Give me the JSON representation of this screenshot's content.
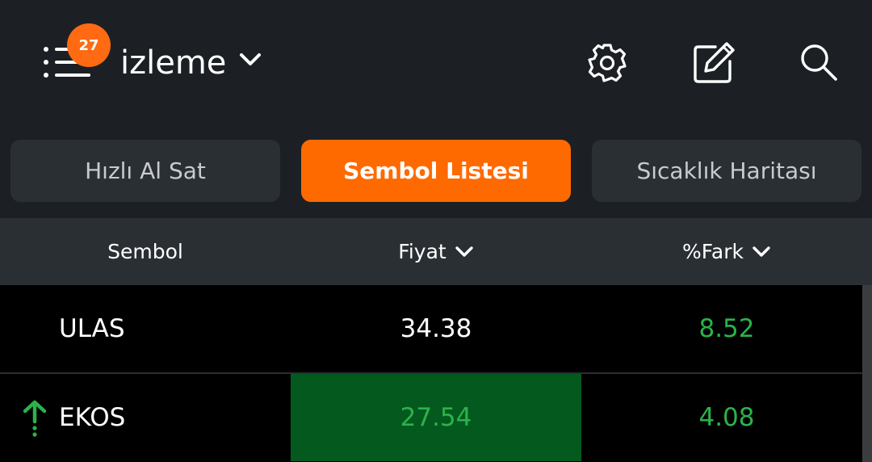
{
  "header": {
    "badge_count": "27",
    "list_name": "izleme",
    "icons": [
      "menu-list-icon",
      "chevron-down-icon",
      "gear-icon",
      "edit-icon",
      "search-icon"
    ]
  },
  "tabs": [
    {
      "label": "Hızlı Al Sat",
      "active": false
    },
    {
      "label": "Sembol Listesi",
      "active": true
    },
    {
      "label": "Sıcaklık Haritası",
      "active": false
    }
  ],
  "columns": {
    "symbol": "Sembol",
    "price": "Fiyat",
    "change": "%Fark"
  },
  "rows": [
    {
      "symbol": "ULAS",
      "price": "34.38",
      "change": "8.52",
      "indicator": null
    },
    {
      "symbol": "EKOS",
      "price": "27.54",
      "change": "4.08",
      "indicator": "up-arrow-icon"
    }
  ],
  "colors": {
    "accent": "#ff6a00",
    "background": "#1c2024",
    "positive": "#2bb34a",
    "flash_up": "#04591e"
  }
}
